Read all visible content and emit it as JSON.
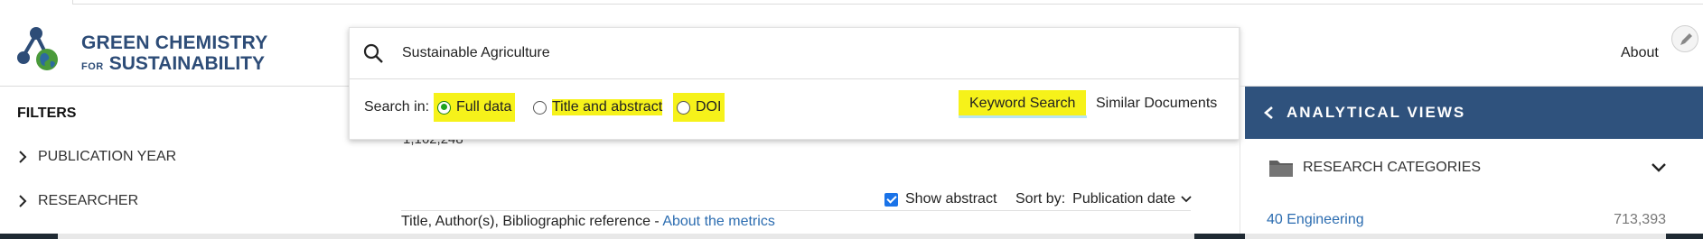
{
  "logo": {
    "line1": "GREEN CHEMISTRY",
    "line2_small": "FOR",
    "line2_big": "SUSTAINABILITY"
  },
  "filters": {
    "title": "FILTERS",
    "items": [
      {
        "label": "PUBLICATION YEAR"
      },
      {
        "label": "RESEARCHER"
      }
    ]
  },
  "search": {
    "value": "Sustainable Agriculture",
    "search_in_label": "Search in:",
    "options": [
      {
        "label": "Full data",
        "selected": true
      },
      {
        "label": "Title and abstract",
        "selected": false
      },
      {
        "label": "DOI",
        "selected": false
      }
    ],
    "keyword_search_label": "Keyword Search",
    "similar_documents_label": "Similar Documents"
  },
  "results": {
    "count": "1,162,248",
    "show_abstract_label": "Show abstract",
    "show_abstract_checked": true,
    "sort_by_label": "Sort by:",
    "sort_by_value": "Publication date",
    "header_text": "Title, Author(s), Bibliographic reference - ",
    "header_link": "About the metrics"
  },
  "right": {
    "about_label": "About",
    "analytical_views_title": "ANALYTICAL VIEWS",
    "research_categories_label": "RESEARCH CATEGORIES",
    "categories": [
      {
        "name": "40 Engineering",
        "count": "713,393"
      }
    ]
  },
  "colors": {
    "brand_navy": "#2d4c77",
    "header_bg": "#2f527d",
    "highlight": "#f6f21a",
    "link": "#2b6cb0",
    "radio_selected": "#1fa31f"
  },
  "icons": {
    "search": "search-icon",
    "chevron_right": "chevron-right-icon",
    "chevron_left": "chevron-left-icon",
    "chevron_down": "chevron-down-icon",
    "folder": "folder-icon",
    "pencil": "pencil-icon"
  }
}
